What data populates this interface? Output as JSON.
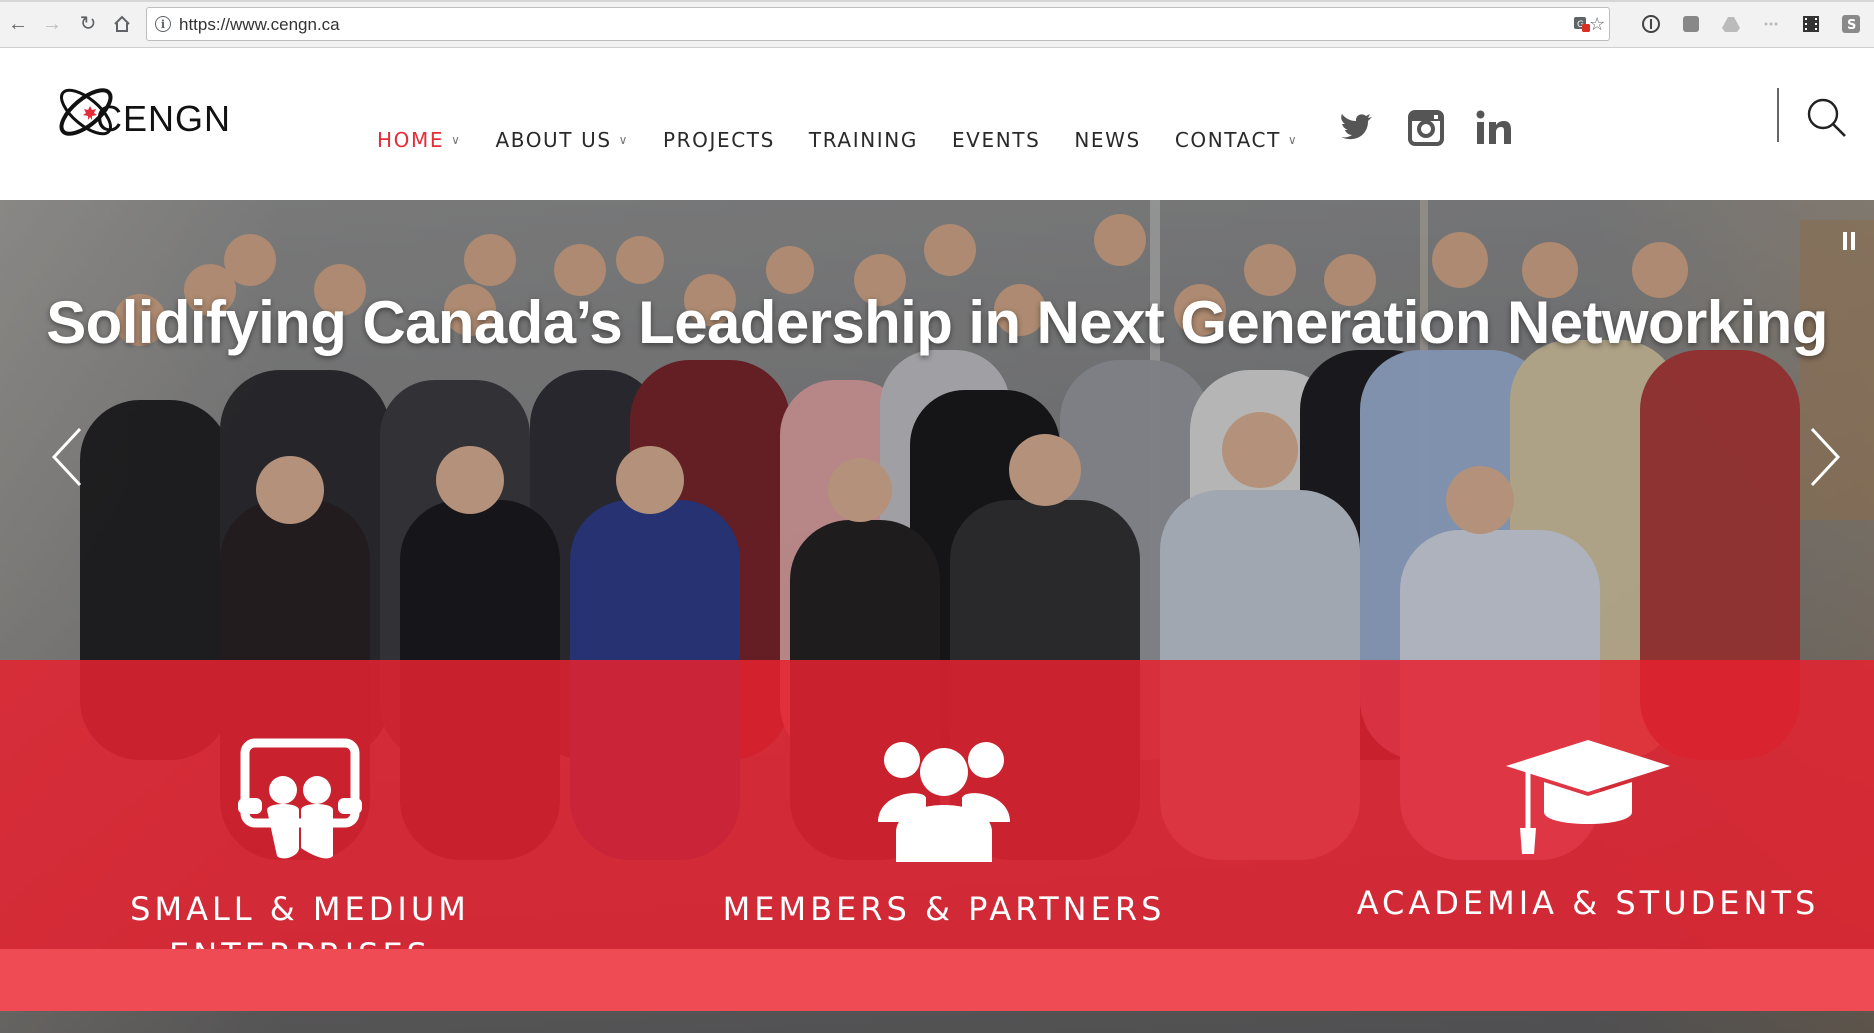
{
  "browser": {
    "url": "https://www.cengn.ca",
    "back_icon": "back-arrow-icon",
    "forward_icon": "forward-arrow-icon",
    "reload_icon": "reload-icon",
    "home_icon": "home-icon"
  },
  "site": {
    "logo_text": "CENGN",
    "brand_color": "#e52d3a",
    "nav": [
      {
        "label": "HOME",
        "active": true,
        "dropdown": true
      },
      {
        "label": "ABOUT US",
        "active": false,
        "dropdown": true
      },
      {
        "label": "PROJECTS",
        "active": false,
        "dropdown": false
      },
      {
        "label": "TRAINING",
        "active": false,
        "dropdown": false
      },
      {
        "label": "EVENTS",
        "active": false,
        "dropdown": false
      },
      {
        "label": "NEWS",
        "active": false,
        "dropdown": false
      },
      {
        "label": "CONTACT",
        "active": false,
        "dropdown": true
      }
    ],
    "social": [
      "twitter-icon",
      "instagram-icon",
      "linkedin-icon"
    ]
  },
  "hero": {
    "title": "Solidifying Canada’s Leadership in Next Generation Networking",
    "overlay_color": "#e52230"
  },
  "audiences": [
    {
      "label": "SMALL & MEDIUM ENTERPRISES",
      "icon": "presentation-people-icon"
    },
    {
      "label": "MEMBERS & PARTNERS",
      "icon": "group-icon"
    },
    {
      "label": "ACADEMIA & STUDENTS",
      "icon": "graduation-cap-icon"
    }
  ]
}
